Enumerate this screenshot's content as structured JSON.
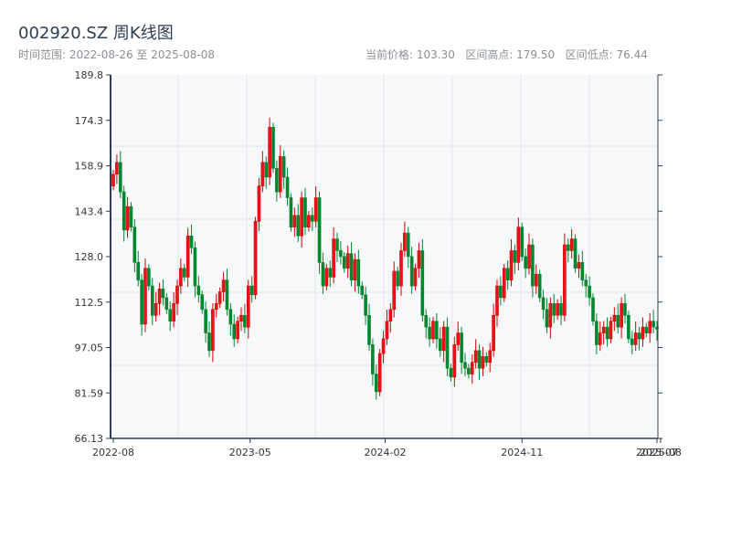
{
  "header": {
    "title": "002920.SZ 周K线图",
    "range": "时间范围: 2022-08-26 至 2025-08-08",
    "current": "当前价格: 103.30",
    "high": "区间高点: 179.50",
    "low": "区间低点: 76.44"
  },
  "chart_data": {
    "type": "candlestick",
    "title": "002920.SZ 周K线图",
    "ylim": [
      66.13,
      189.8
    ],
    "yticks": [
      "66.13",
      "81.59",
      "97.05",
      "112.5",
      "128.0",
      "143.4",
      "158.9",
      "174.3",
      "189.8"
    ],
    "xticks": [
      {
        "label": "2022-08",
        "week": 0
      },
      {
        "label": "2023-05",
        "week": 38.5
      },
      {
        "label": "2024-02",
        "week": 76.5
      },
      {
        "label": "2024-11",
        "week": 115
      },
      {
        "label": "2025-07",
        "week": 153
      },
      {
        "label": "2025-08",
        "week": 154
      }
    ],
    "colors": {
      "up": "#d40000",
      "down": "#00862e"
    },
    "open_first": 152,
    "close": [
      156,
      160,
      150,
      137,
      145,
      138,
      126,
      120,
      105,
      124,
      118,
      108,
      112,
      117,
      114,
      110,
      106,
      112,
      118,
      124,
      121,
      135,
      131,
      118,
      115,
      110,
      102,
      96,
      110,
      112,
      116,
      120,
      110,
      105,
      100,
      106,
      108,
      104,
      118,
      115,
      140,
      152,
      160,
      155,
      172,
      158,
      150,
      162,
      155,
      148,
      138,
      142,
      135,
      148,
      138,
      142,
      140,
      148,
      126,
      118,
      124,
      121,
      134,
      130,
      128,
      124,
      129,
      120,
      127,
      118,
      115,
      108,
      98,
      88,
      82,
      95,
      100,
      106,
      110,
      123,
      118,
      130,
      136,
      128,
      118,
      124,
      130,
      108,
      104,
      100,
      106,
      100,
      96,
      104,
      90,
      87,
      98,
      102,
      92,
      90,
      88,
      92,
      96,
      90,
      94,
      92,
      96,
      108,
      118,
      114,
      124,
      120,
      130,
      126,
      138,
      128,
      124,
      132,
      118,
      122,
      114,
      110,
      104,
      112,
      108,
      112,
      108,
      132,
      130,
      134,
      124,
      126,
      120,
      118,
      114,
      106,
      98,
      102,
      104,
      100,
      106,
      108,
      104,
      112,
      108,
      100,
      98,
      102,
      100,
      104,
      102,
      106,
      104,
      103.3
    ]
  }
}
